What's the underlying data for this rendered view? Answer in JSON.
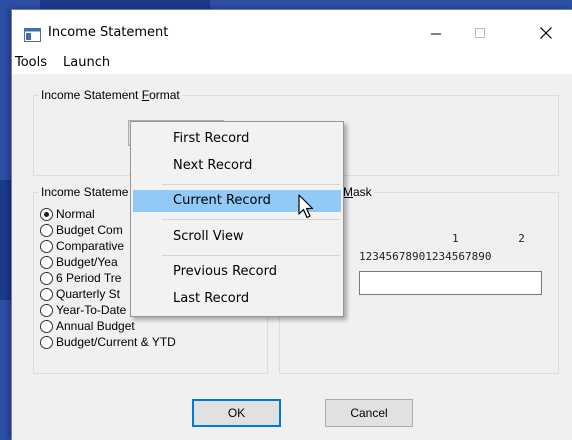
{
  "window": {
    "title": "Income Statement"
  },
  "menubar": {
    "items": [
      {
        "label": "Tools"
      },
      {
        "label": "Launch"
      }
    ]
  },
  "format_group": {
    "label_prefix": "Income Statement ",
    "label_mnemonic": "F",
    "label_suffix": "ormat"
  },
  "type_group": {
    "label": "Income Stateme",
    "options": [
      {
        "label": "Normal",
        "selected": true
      },
      {
        "label": "Budget Com",
        "selected": false
      },
      {
        "label": "Comparative",
        "selected": false
      },
      {
        "label": "Budget/Yea",
        "selected": false
      },
      {
        "label": "6 Period Tre",
        "selected": false
      },
      {
        "label": "Quarterly St",
        "selected": false
      },
      {
        "label": "Year-To-Date Only",
        "selected": false
      },
      {
        "label": "Annual Budget",
        "selected": false
      },
      {
        "label": "Budget/Current & YTD",
        "selected": false
      }
    ]
  },
  "mask_group": {
    "label_mnemonic": "M",
    "label_suffix": "ask",
    "ruler_tens": "1         2",
    "ruler_units": "12345678901234567890",
    "input_value": ""
  },
  "buttons": {
    "ok_label": "OK",
    "cancel_label": "Cancel"
  },
  "context_menu": {
    "items": [
      {
        "label": "First Record"
      },
      {
        "label": "Next Record"
      },
      {
        "label": "Current Record",
        "highlighted": true
      },
      {
        "label": "Scroll View"
      },
      {
        "label": "Previous Record"
      },
      {
        "label": "Last Record"
      }
    ]
  },
  "colors": {
    "desktop": "#2d4fa6",
    "menu_highlight": "#91c9f7",
    "default_button_border": "#0078d7"
  }
}
